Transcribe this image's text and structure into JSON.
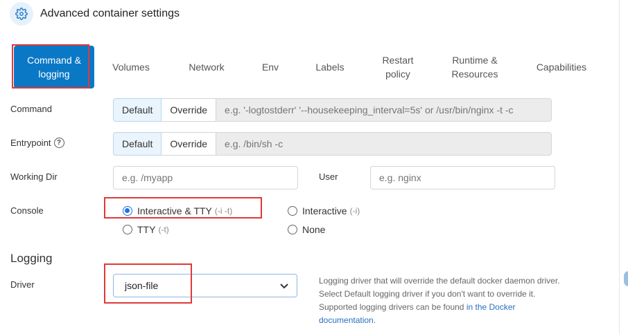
{
  "header": {
    "title": "Advanced container settings",
    "icon": "gear-icon"
  },
  "tabs": [
    {
      "line1": "Command &",
      "line2": "logging",
      "active": true
    },
    {
      "line1": "Volumes",
      "line2": ""
    },
    {
      "line1": "Network",
      "line2": ""
    },
    {
      "line1": "Env",
      "line2": ""
    },
    {
      "line1": "Labels",
      "line2": ""
    },
    {
      "line1": "Restart",
      "line2": "policy"
    },
    {
      "line1": "Runtime &",
      "line2": "Resources"
    },
    {
      "line1": "Capabilities",
      "line2": ""
    }
  ],
  "command": {
    "label": "Command",
    "default_label": "Default",
    "override_label": "Override",
    "placeholder": "e.g. '-logtostderr' '--housekeeping_interval=5s' or /usr/bin/nginx -t -c"
  },
  "entrypoint": {
    "label": "Entrypoint",
    "help": "?",
    "default_label": "Default",
    "override_label": "Override",
    "placeholder": "e.g. /bin/sh -c"
  },
  "working_dir": {
    "label": "Working Dir",
    "placeholder": "e.g. /myapp"
  },
  "user": {
    "label": "User",
    "placeholder": "e.g. nginx"
  },
  "console": {
    "label": "Console",
    "options": [
      {
        "label": "Interactive & TTY",
        "flag": "(-i -t)",
        "checked": true
      },
      {
        "label": "Interactive",
        "flag": "(-i)",
        "checked": false
      },
      {
        "label": "TTY",
        "flag": "(-t)",
        "checked": false
      },
      {
        "label": "None",
        "flag": "",
        "checked": false
      }
    ]
  },
  "logging": {
    "title": "Logging",
    "driver_label": "Driver",
    "driver_value": "json-file",
    "help_text": "Logging driver that will override the default docker daemon driver. Select Default logging driver if you don't want to override it. Supported logging drivers can be found ",
    "help_link": "in the Docker documentation",
    "help_end": "."
  },
  "colors": {
    "accent": "#0b78c6",
    "highlight": "#e03838",
    "radio": "#1a73e8"
  }
}
